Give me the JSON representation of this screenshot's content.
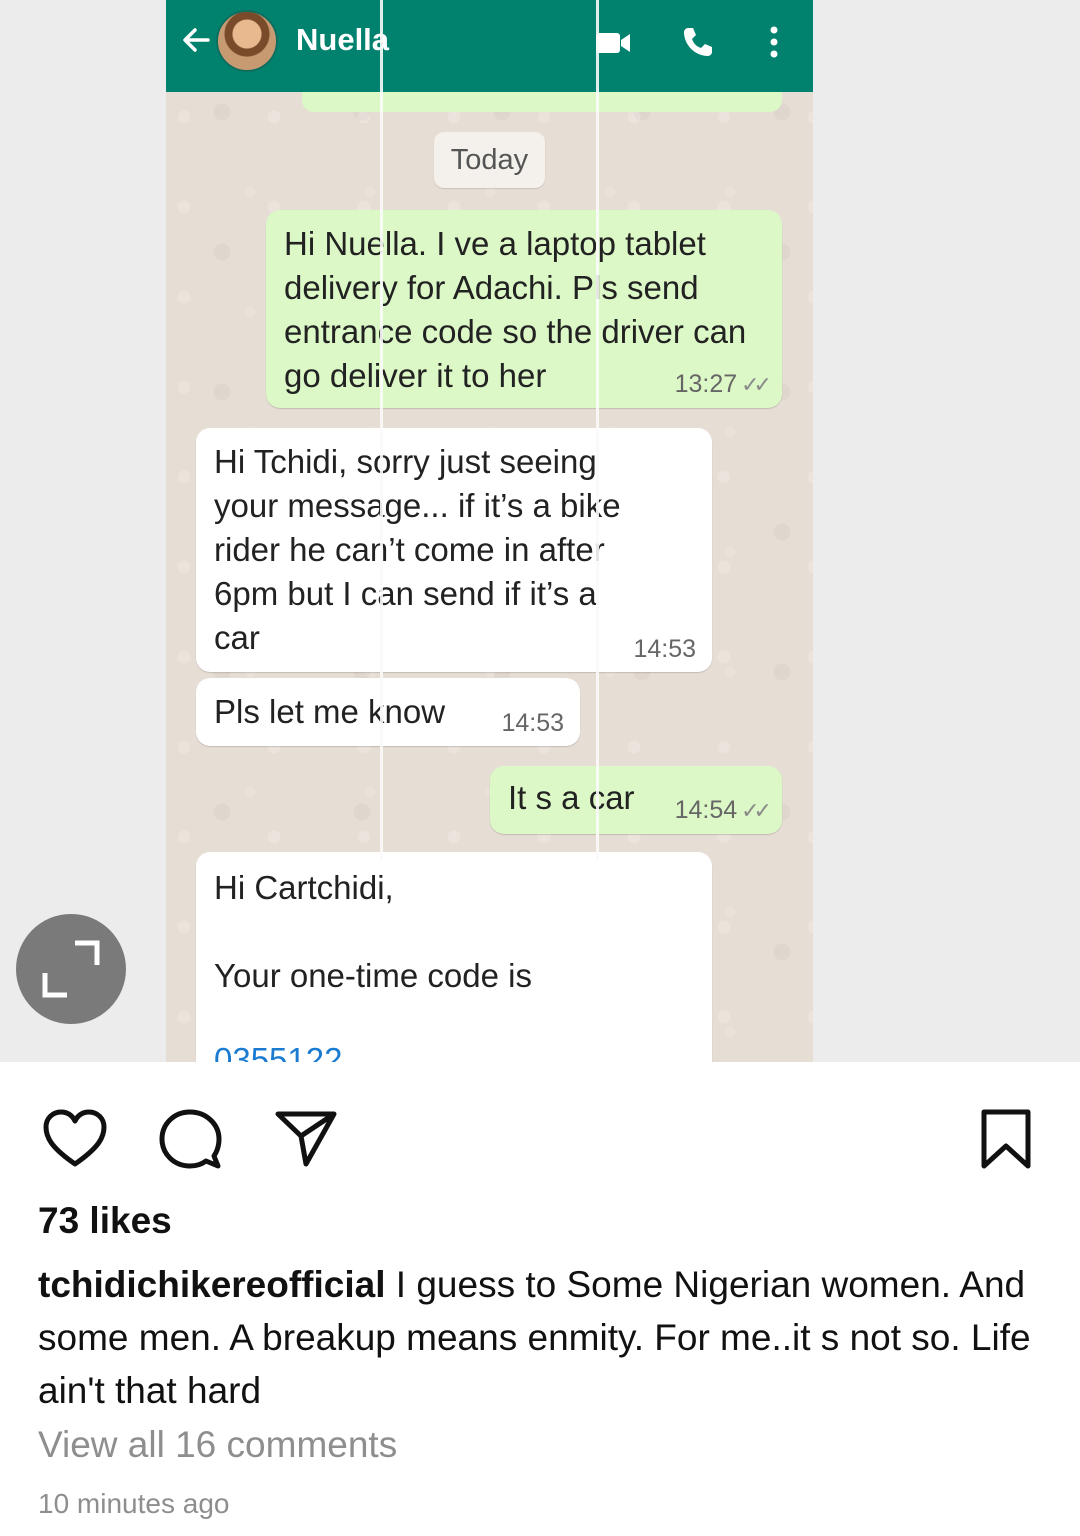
{
  "chat": {
    "contact_name": "Nuella",
    "date_label": "Today",
    "messages": [
      {
        "direction": "out",
        "text": "Hi Nuella. I ve a laptop tablet delivery for Adachi. Pls send entrance code so the driver can go deliver it to her",
        "time": "13:27",
        "read_ticks": "✓✓"
      },
      {
        "direction": "in",
        "text": "Hi Tchidi, sorry just seeing your message... if it’s a bike rider he can’t come in after 6pm but I can send if it’s a car",
        "time": "14:53"
      },
      {
        "direction": "in",
        "text": "Pls let me know",
        "time": "14:53"
      },
      {
        "direction": "out",
        "text": "It s a car",
        "time": "14:54",
        "read_ticks": "✓✓"
      },
      {
        "direction": "in",
        "greeting": "Hi Cartchidi,",
        "text": "Your one-time code is",
        "code_partial": "0355122"
      }
    ]
  },
  "post": {
    "likes": "73 likes",
    "username": "tchidichikereofficial",
    "caption": "I guess to Some Nigerian women. And some men. A breakup means enmity.  For me..it s not so. Life ain't that hard",
    "view_comments": "View all 16 comments",
    "time_ago": "10 minutes ago"
  },
  "icons": {
    "header": [
      "back-arrow-icon",
      "avatar",
      "video-call-icon",
      "phone-icon",
      "more-options-icon"
    ],
    "overlay": [
      "expand-icon"
    ],
    "actions": [
      "heart-icon",
      "comment-icon",
      "share-icon",
      "bookmark-icon"
    ]
  },
  "colors": {
    "whatsapp_header": "#00826f",
    "outgoing_bubble": "#dcf8c6",
    "incoming_bubble": "#ffffff",
    "chat_background": "#e6ddd4",
    "muted_text": "#8e8e8e"
  }
}
